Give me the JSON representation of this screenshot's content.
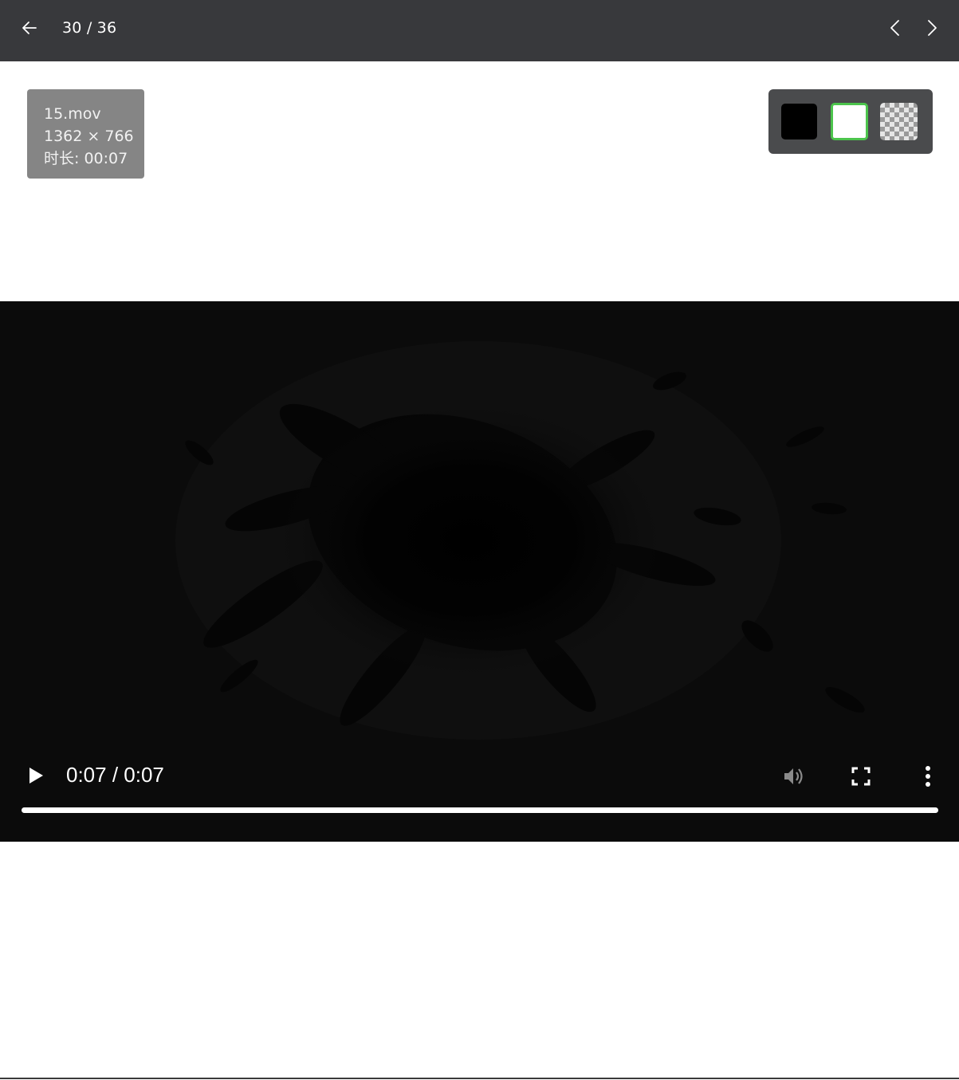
{
  "header": {
    "counter": "30 / 36",
    "back_icon": "arrow-left-icon",
    "prev_icon": "chevron-left-icon",
    "next_icon": "chevron-right-icon"
  },
  "file_info": {
    "name": "15.mov",
    "dimensions": "1362 × 766",
    "duration": "时长: 00:07"
  },
  "background_options": {
    "options": [
      "black",
      "white",
      "checkerboard"
    ],
    "selected": "white",
    "selected_border_color": "#4cc44c"
  },
  "player": {
    "time_display": "0:07 / 0:07",
    "progress_fraction": 1.0,
    "play_icon": "play-icon",
    "volume_icon": "volume-icon",
    "fullscreen_icon": "fullscreen-icon",
    "more_icon": "more-vertical-icon"
  },
  "colors": {
    "header_bg": "#38393c",
    "info_card_bg": "#858585",
    "switcher_bg": "#4a4b4d",
    "video_bg": "#0b0b0b"
  }
}
